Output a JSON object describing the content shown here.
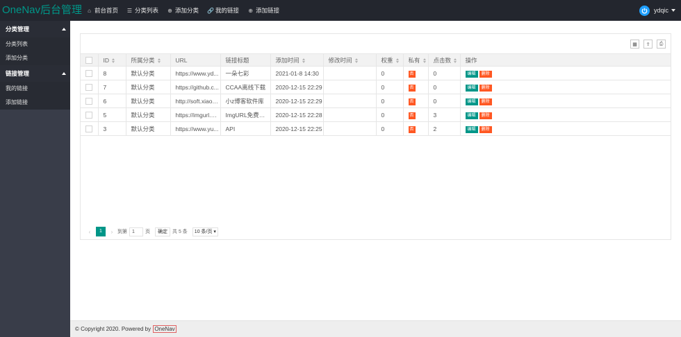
{
  "header": {
    "logo": "OneNav后台管理",
    "nav": [
      {
        "icon": "home-icon",
        "label": "前台首页"
      },
      {
        "icon": "list-icon",
        "label": "分类列表"
      },
      {
        "icon": "add-circle-icon",
        "label": "添加分类"
      },
      {
        "icon": "link-icon",
        "label": "我的链接"
      },
      {
        "icon": "add-circle-icon",
        "label": "添加链接"
      }
    ],
    "user": "ydqic"
  },
  "sidebar": {
    "groups": [
      {
        "title": "分类管理",
        "items": [
          "分类列表",
          "添加分类"
        ]
      },
      {
        "title": "链接管理",
        "items": [
          "我的链接",
          "添加链接"
        ]
      }
    ]
  },
  "table": {
    "columns": [
      "ID",
      "所属分类",
      "URL",
      "链接标题",
      "添加时间",
      "修改时间",
      "权重",
      "私有",
      "点击数",
      "操作"
    ],
    "rows": [
      {
        "id": "8",
        "category": "默认分类",
        "url": "https://www.yd...",
        "title": "一朵七彩",
        "added": "2021-01-8 14:30",
        "modified": "",
        "weight": "0",
        "private": "否",
        "clicks": "0"
      },
      {
        "id": "7",
        "category": "默认分类",
        "url": "https://github.c...",
        "title": "CCAA离线下载",
        "added": "2020-12-15 22:29",
        "modified": "",
        "weight": "0",
        "private": "否",
        "clicks": "0"
      },
      {
        "id": "6",
        "category": "默认分类",
        "url": "http://soft.xiaoz...",
        "title": "小z博客软件库",
        "added": "2020-12-15 22:29",
        "modified": "",
        "weight": "0",
        "private": "否",
        "clicks": "0"
      },
      {
        "id": "5",
        "category": "默认分类",
        "url": "https://imgurl.org/",
        "title": "ImgURL免费图床",
        "added": "2020-12-15 22:28",
        "modified": "",
        "weight": "0",
        "private": "否",
        "clicks": "3"
      },
      {
        "id": "3",
        "category": "默认分类",
        "url": "https://www.yu...",
        "title": "API",
        "added": "2020-12-15 22:25",
        "modified": "",
        "weight": "0",
        "private": "否",
        "clicks": "2"
      }
    ],
    "edit_label": "编辑",
    "delete_label": "删除"
  },
  "pager": {
    "current": "1",
    "goto_label": "到第",
    "goto_value": "1",
    "page_unit": "页",
    "confirm_label": "确定",
    "total_label": "共 5 条",
    "per_page": "10 条/页"
  },
  "footer": {
    "text": "© Copyright 2020. Powered by",
    "link": "OneNav"
  },
  "colors": {
    "accent": "#009688",
    "danger": "#ff5722",
    "header_bg": "#23262e",
    "sidebar_bg": "#393d49"
  }
}
